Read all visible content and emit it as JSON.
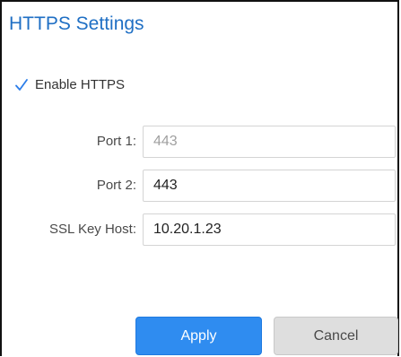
{
  "dialog": {
    "title": "HTTPS Settings"
  },
  "enable_https": {
    "label": "Enable HTTPS",
    "checked": true,
    "icon": "checkmark-icon"
  },
  "fields": {
    "port1": {
      "label": "Port 1:",
      "value": "443",
      "disabled": true
    },
    "port2": {
      "label": "Port 2:",
      "value": "443",
      "disabled": false
    },
    "ssl_key_host": {
      "label": "SSL Key Host:",
      "value": "10.20.1.23",
      "disabled": false
    }
  },
  "buttons": {
    "apply_label": "Apply",
    "cancel_label": "Cancel"
  },
  "colors": {
    "title": "#1f6fc4",
    "apply_bg": "#2f8cf0",
    "cancel_bg": "#dedede",
    "checkmark": "#2b7de9"
  }
}
